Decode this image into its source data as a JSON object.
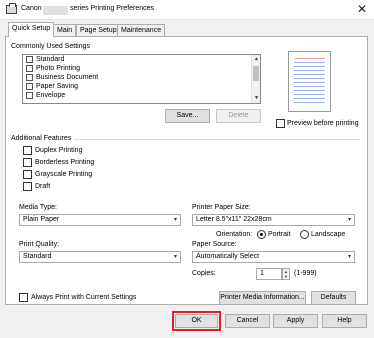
{
  "window": {
    "title_prefix": "Canon",
    "title_suffix": "series Printing Preferences",
    "close_glyph": "✕"
  },
  "tabs": [
    {
      "label": "Quick Setup",
      "active": true
    },
    {
      "label": "Main",
      "active": false
    },
    {
      "label": "Page Setup",
      "active": false
    },
    {
      "label": "Maintenance",
      "active": false
    }
  ],
  "commonly_used": {
    "label": "Commonly Used Settings",
    "items": [
      "Standard",
      "Photo Printing",
      "Business Document",
      "Paper Saving",
      "Envelope"
    ],
    "save_label": "Save...",
    "delete_label": "Delete"
  },
  "preview": {
    "checkbox_label": "Preview before printing",
    "checked": false
  },
  "additional_features": {
    "label": "Additional Features",
    "items": [
      "Duplex Printing",
      "Borderless Printing",
      "Grayscale Printing",
      "Draft"
    ]
  },
  "media_type": {
    "label": "Media Type:",
    "value": "Plain Paper"
  },
  "printer_paper_size": {
    "label": "Printer Paper Size:",
    "value": "Letter 8.5\"x11\" 22x28cm"
  },
  "orientation": {
    "label": "Orientation:",
    "options": [
      "Portrait",
      "Landscape"
    ],
    "selected": "Portrait"
  },
  "print_quality": {
    "label": "Print Quality:",
    "value": "Standard"
  },
  "paper_source": {
    "label": "Paper Source:",
    "value": "Automatically Select"
  },
  "copies": {
    "label": "Copies:",
    "value": "1",
    "range": "(1-999)"
  },
  "always_print": {
    "label": "Always Print with Current Settings"
  },
  "printer_media_info_label": "Printer Media Information...",
  "defaults_label": "Defaults",
  "footer": {
    "ok": "OK",
    "cancel": "Cancel",
    "apply": "Apply",
    "help": "Help"
  },
  "colors": {
    "highlight": "#e0201e",
    "panel": "#ffffff",
    "dialog_bg": "#f0f0f0"
  },
  "icons": {
    "dropdown": "▾",
    "scroll_up": "▲",
    "scroll_down": "▼",
    "spin_up": "▲",
    "spin_down": "▼"
  }
}
